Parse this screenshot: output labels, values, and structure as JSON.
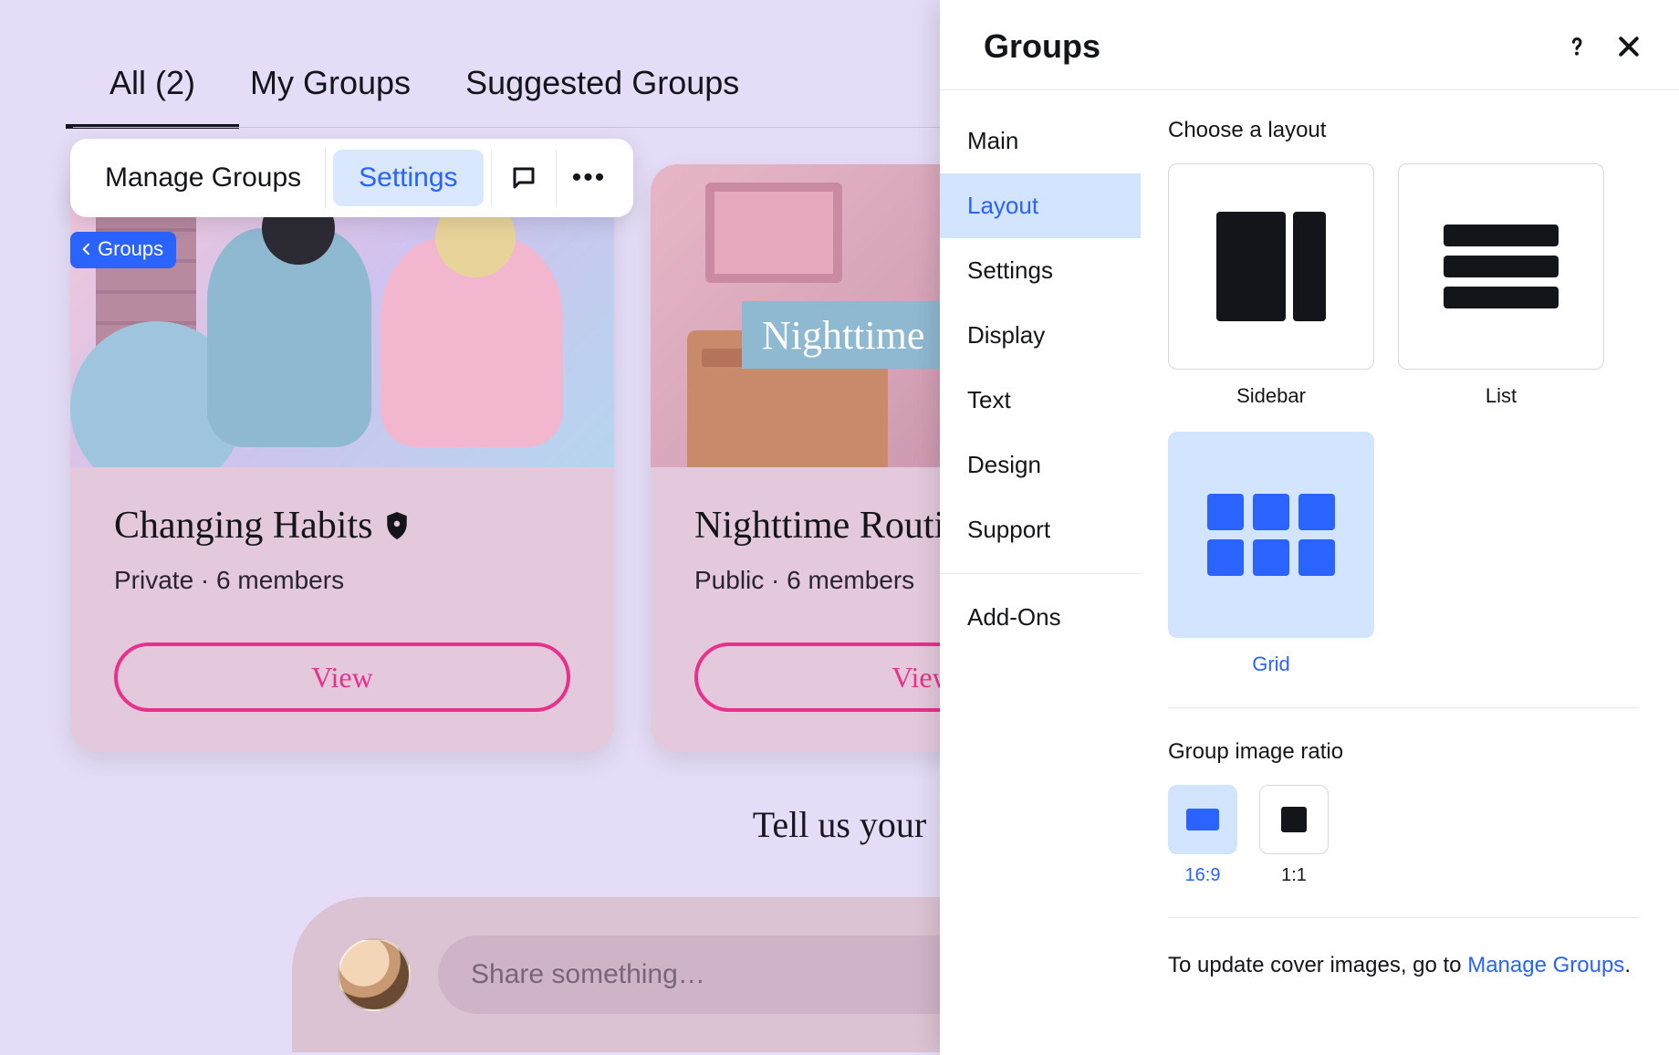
{
  "tabs": {
    "all": "All (2)",
    "my_groups": "My Groups",
    "suggested": "Suggested Groups"
  },
  "toolbar": {
    "manage": "Manage Groups",
    "settings": "Settings"
  },
  "back_chip": "Groups",
  "cards": [
    {
      "title": "Changing Habits",
      "meta": "Private · 6 members",
      "view": "View",
      "has_badge": true
    },
    {
      "title": "Nighttime Routine",
      "meta": "Public · 6 members",
      "view": "View",
      "banner": "Nighttime"
    }
  ],
  "feedback": {
    "title": "Tell us your",
    "placeholder": "Share something…"
  },
  "panel": {
    "title": "Groups",
    "nav": {
      "main": "Main",
      "layout": "Layout",
      "settings": "Settings",
      "display": "Display",
      "text": "Text",
      "design": "Design",
      "support": "Support",
      "addons": "Add-Ons"
    },
    "choose_layout": "Choose a layout",
    "layouts": {
      "sidebar": "Sidebar",
      "list": "List",
      "grid": "Grid"
    },
    "ratio_label": "Group image ratio",
    "ratios": {
      "r169": "16:9",
      "r11": "1:1"
    },
    "hint_prefix": "To update cover images, go to ",
    "hint_link": "Manage Groups",
    "hint_suffix": "."
  }
}
